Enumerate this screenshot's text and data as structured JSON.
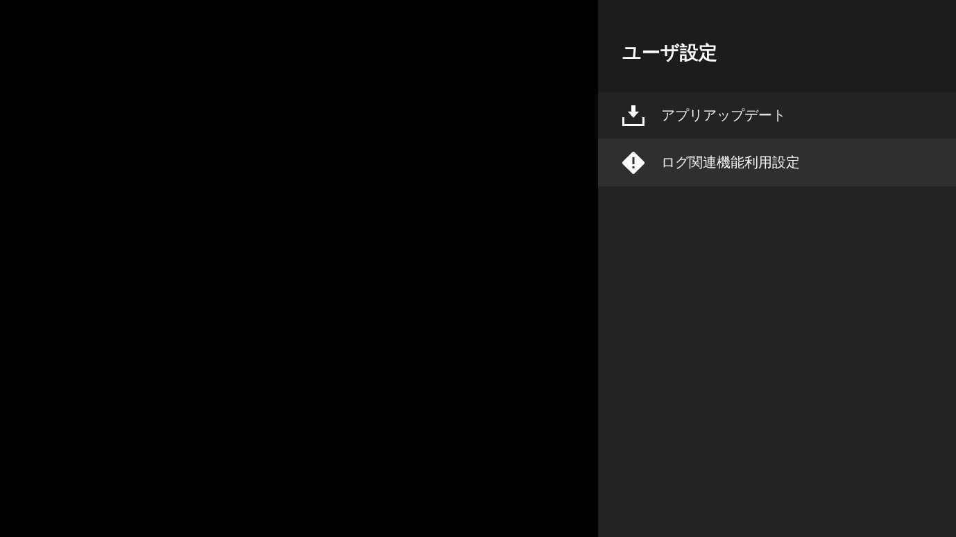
{
  "panel": {
    "title": "ユーザ設定",
    "items": [
      {
        "kind": "update",
        "label": "アプリアップデート",
        "selected": false
      },
      {
        "kind": "alert",
        "label": "ログ関連機能利用設定",
        "selected": true
      }
    ]
  }
}
